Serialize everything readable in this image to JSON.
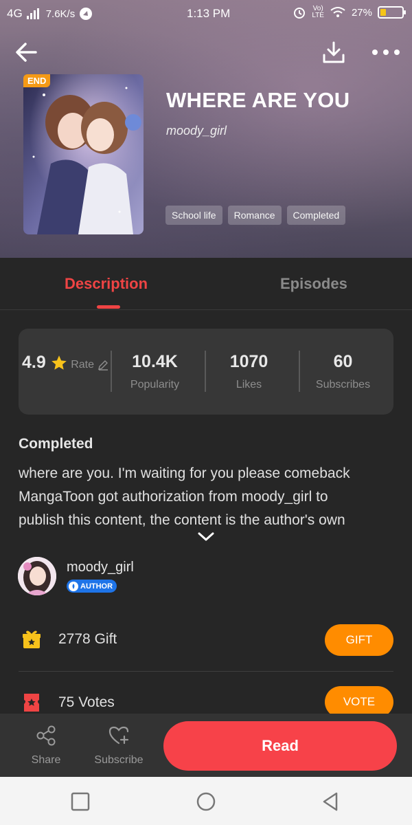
{
  "status_bar": {
    "network": "4G",
    "speed": "7.6K/s",
    "time": "1:13 PM",
    "volte": "Vo)\nLTE",
    "battery_percent": "27%",
    "battery_level": 0.27
  },
  "header": {
    "end_badge": "END",
    "title": "WHERE ARE YOU",
    "author": "moody_girl",
    "tags": [
      "School life",
      "Romance",
      "Completed"
    ],
    "icons": [
      "back-arrow-icon",
      "download-icon",
      "more-icon"
    ]
  },
  "tabs": {
    "description": "Description",
    "episodes": "Episodes"
  },
  "stats": {
    "rate": {
      "value": "4.9",
      "label": "Rate"
    },
    "popularity": {
      "value": "10.4K",
      "label": "Popularity"
    },
    "likes": {
      "value": "1070",
      "label": "Likes"
    },
    "subscribes": {
      "value": "60",
      "label": "Subscribes"
    }
  },
  "description": {
    "heading": "Completed",
    "line1": "where are you. I'm waiting for you please comeback",
    "line2": "MangaToon got authorization from moody_girl to",
    "line3": "publish this content, the content is the author's own"
  },
  "author_row": {
    "name": "moody_girl",
    "badge": "AUTHOR"
  },
  "gift": {
    "count": "2778",
    "label": "Gift",
    "button": "GIFT"
  },
  "votes": {
    "count": "75",
    "label": "Votes",
    "button": "VOTE"
  },
  "action_bar": {
    "share": "Share",
    "subscribe": "Subscribe",
    "read": "Read"
  },
  "colors": {
    "accent_red": "#ef4444",
    "read_button": "#f74249",
    "orange_button": "#ff8c00",
    "background": "#262626"
  }
}
